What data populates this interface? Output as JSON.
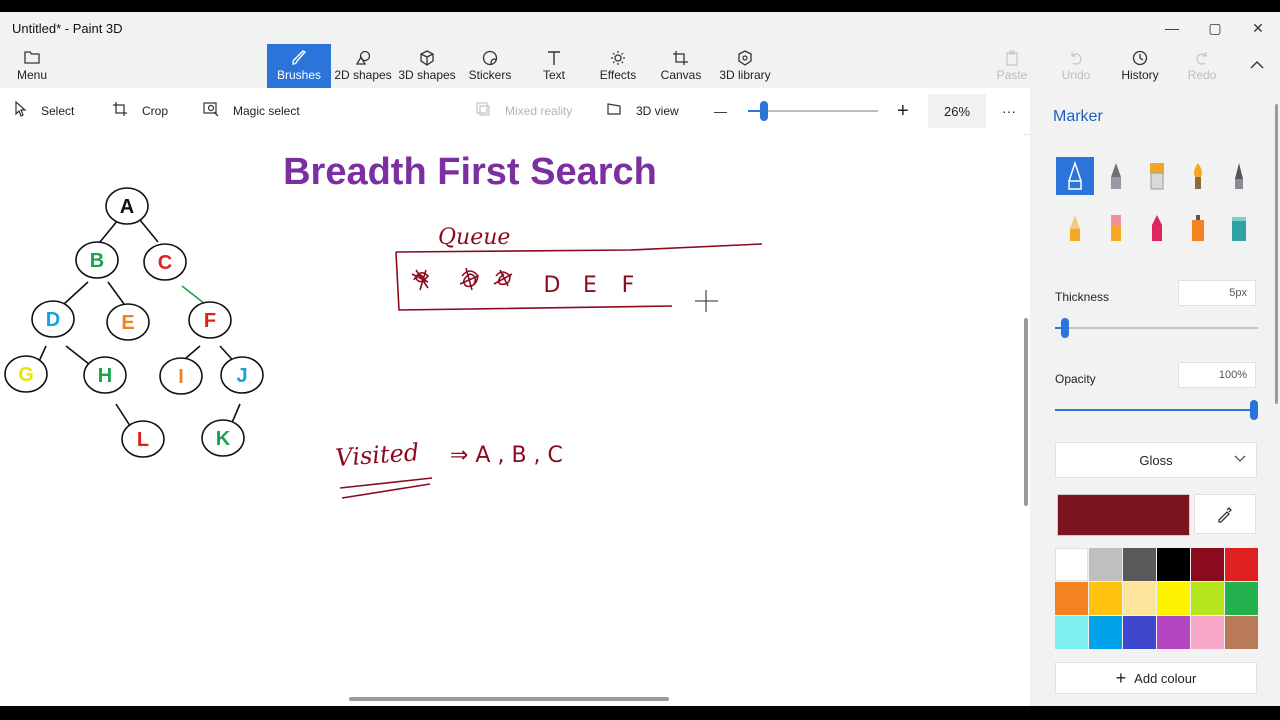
{
  "window": {
    "title": "Untitled* - Paint 3D",
    "controls": {
      "minimize": "—",
      "maximize": "▢",
      "close": "✕"
    }
  },
  "ribbon": {
    "menu": "Menu",
    "tabs": [
      "Brushes",
      "2D shapes",
      "3D shapes",
      "Stickers",
      "Text",
      "Effects",
      "Canvas",
      "3D library"
    ],
    "active_tab": "Brushes",
    "paste": "Paste",
    "undo": "Undo",
    "history": "History",
    "redo": "Redo"
  },
  "toolbar": {
    "select": "Select",
    "crop": "Crop",
    "magic_select": "Magic select",
    "mixed_reality": "Mixed reality",
    "view_3d": "3D view",
    "zoom_minus": "—",
    "zoom_plus": "+",
    "zoom_level": "26%",
    "more": "···",
    "zoom_fraction": 0.12
  },
  "canvas": {
    "heading": "Breadth First Search",
    "tree_nodes": [
      {
        "label": "A",
        "color": "#111111"
      },
      {
        "label": "B",
        "color": "#1aa34a"
      },
      {
        "label": "C",
        "color": "#e02020"
      },
      {
        "label": "D",
        "color": "#1aa0e0"
      },
      {
        "label": "E",
        "color": "#f08020"
      },
      {
        "label": "F",
        "color": "#e02020"
      },
      {
        "label": "G",
        "color": "#e8e800"
      },
      {
        "label": "H",
        "color": "#1aa34a"
      },
      {
        "label": "I",
        "color": "#f08020"
      },
      {
        "label": "J",
        "color": "#1aa0e0"
      },
      {
        "label": "L",
        "color": "#e02020"
      },
      {
        "label": "K",
        "color": "#1aa34a"
      }
    ],
    "queue_label": "Queue",
    "queue_items": [
      "D",
      "E",
      "F"
    ],
    "visited_label": "Visited",
    "visited_items": "⇒ A , B , C",
    "ink_color": "#8b0a1e",
    "heading_color": "#7b2fa0"
  },
  "panel": {
    "title": "Marker",
    "thickness_label": "Thickness",
    "thickness_value": "5px",
    "thickness_fraction": 0.05,
    "opacity_label": "Opacity",
    "opacity_value": "100%",
    "opacity_fraction": 1.0,
    "finish": "Gloss",
    "current_color": "#7a1520",
    "palette": [
      "#ffffff",
      "#bfbfbf",
      "#595959",
      "#000000",
      "#8b0a1e",
      "#e02020",
      "#f58220",
      "#ffc20e",
      "#fde59c",
      "#fff200",
      "#b5e61d",
      "#22b14c",
      "#7ff0f0",
      "#00a2e8",
      "#3f48cc",
      "#b444c0",
      "#f7a8c8",
      "#b97a57"
    ],
    "add_colour": "Add colour"
  }
}
